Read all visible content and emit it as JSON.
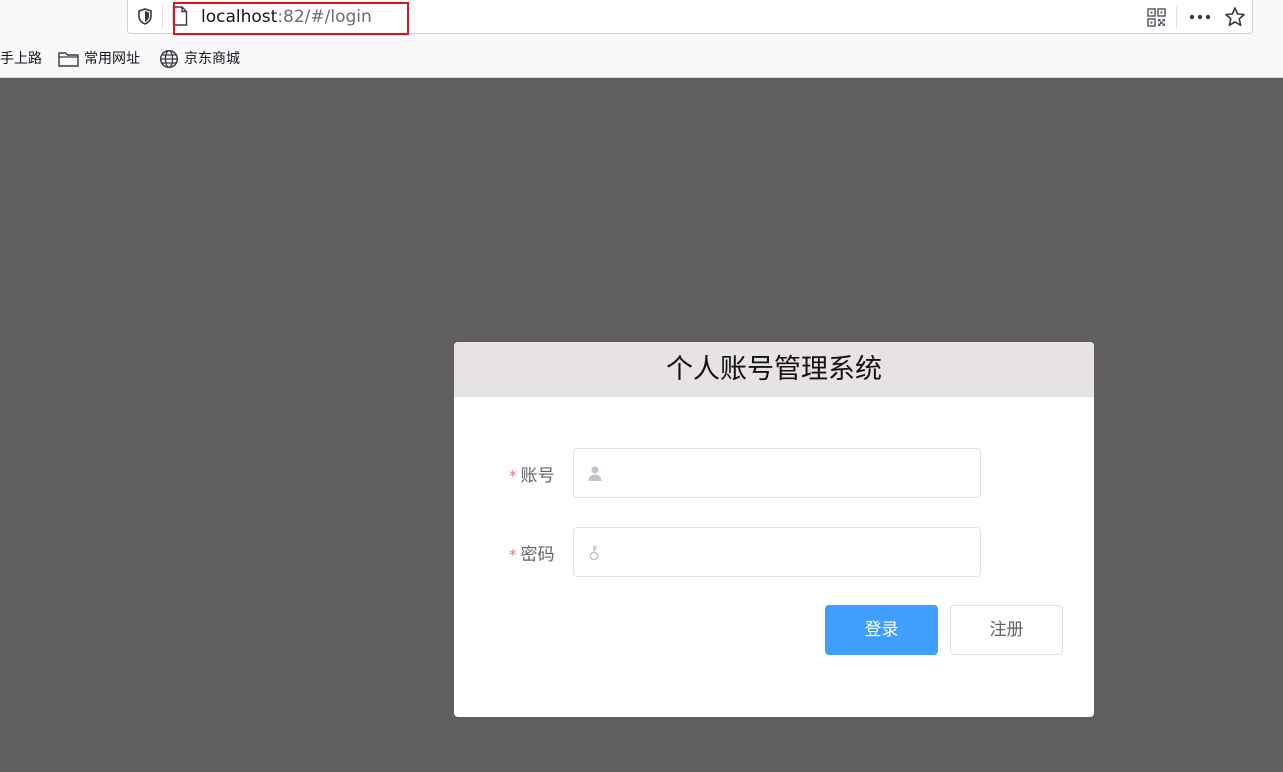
{
  "browser": {
    "url_host": "localhost",
    "url_path": ":82/#/login"
  },
  "bookmarks": [
    {
      "label": "手上路",
      "icon": "none"
    },
    {
      "label": "常用网址",
      "icon": "folder-icon"
    },
    {
      "label": "京东商城",
      "icon": "globe-icon"
    }
  ],
  "login": {
    "title": "个人账号管理系统",
    "required_mark": "*",
    "account_label": "账号",
    "account_value": "",
    "password_label": "密码",
    "password_value": "",
    "login_button": "登录",
    "register_button": "注册"
  },
  "colors": {
    "page_background": "#605f5d",
    "header_background": "#e7e3e2",
    "primary": "#409eff",
    "required": "#f56c6c",
    "url_highlight": "#d91515"
  }
}
